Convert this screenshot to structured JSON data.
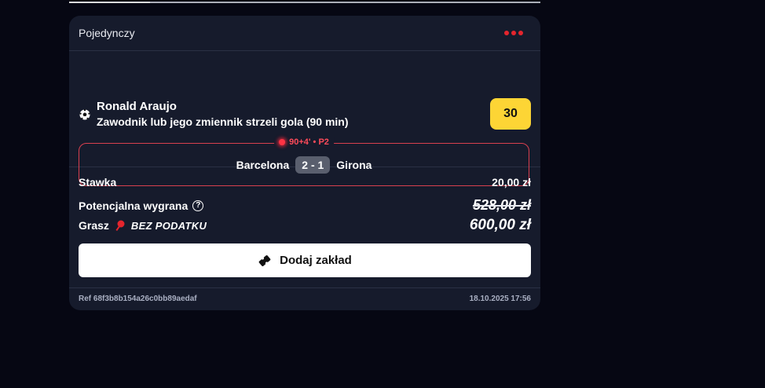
{
  "card": {
    "title": "Pojedynczy",
    "selection": {
      "player": "Ronald Araujo",
      "market": "Zawodnik lub jego zmiennik strzeli gola (90 min)",
      "odds": "30"
    },
    "live": {
      "status": "90+4' • P2",
      "home": "Barcelona",
      "score": "2 - 1",
      "away": "Girona"
    },
    "summary": {
      "stake_label": "Stawka",
      "stake_value": "20,00 zł",
      "potential_label": "Potencjalna wygrana",
      "potential_old": "528,00 zł",
      "grasz_label": "Grasz",
      "bez_label": "BEZ PODATKU",
      "final_value": "600,00 zł"
    },
    "add_button_label": "Dodaj zakład",
    "footer": {
      "ref": "Ref 68f3b8b154a26c0bb89aedaf",
      "date": "18.10.2025 17:56"
    }
  },
  "colors": {
    "background": "#060713",
    "card": "#161b2c",
    "accent_red": "#e5252d",
    "odds_yellow": "#fdd535"
  },
  "icons": [
    "soccer-ball-icon",
    "live-dot-icon",
    "help-icon",
    "pin-icon",
    "ticket-icon",
    "more-dots-icon"
  ]
}
